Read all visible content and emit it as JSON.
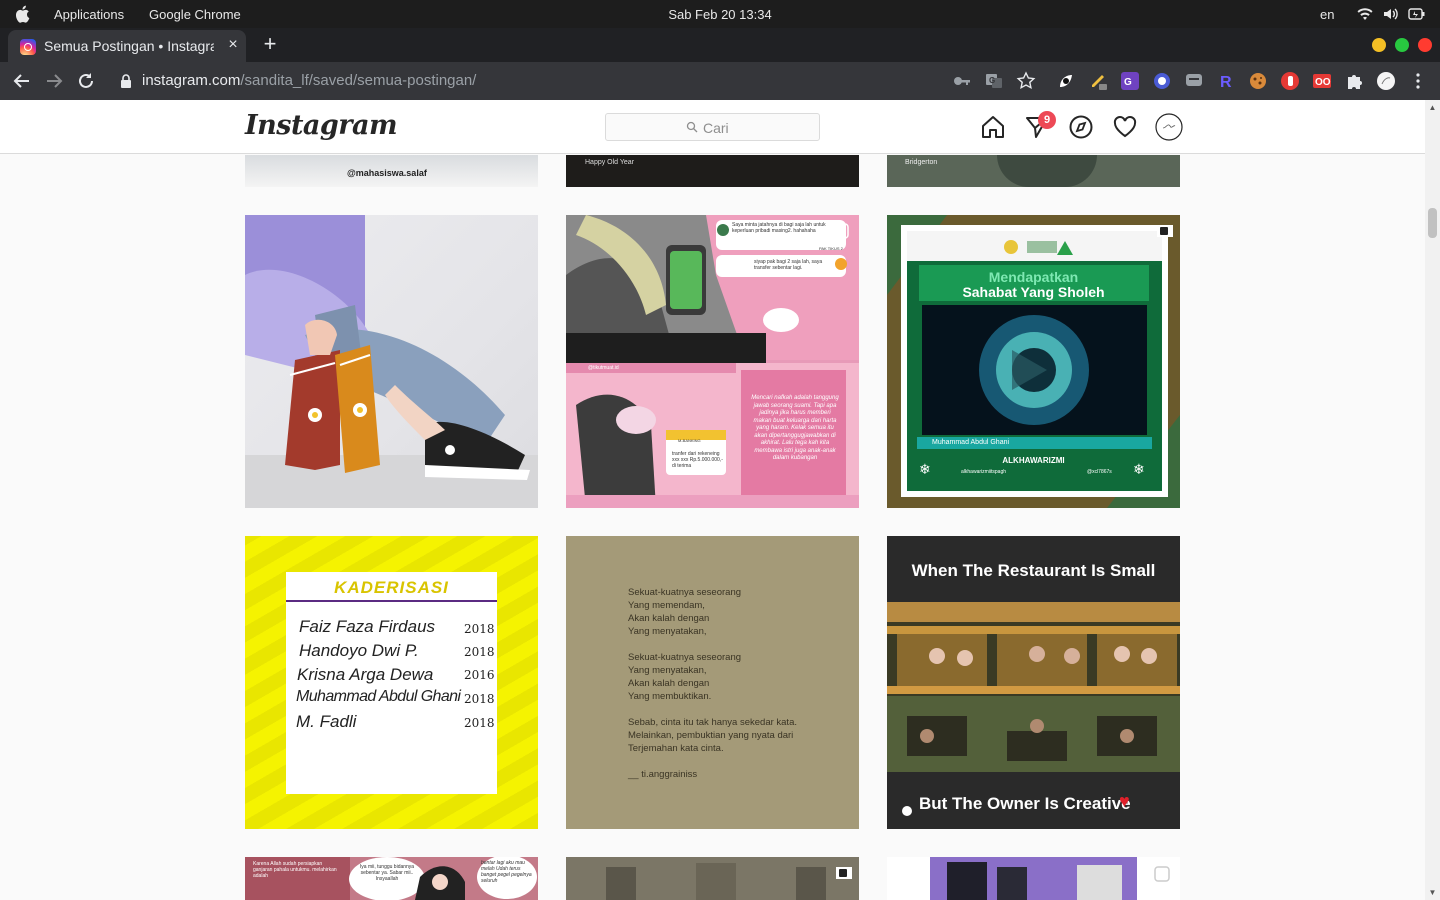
{
  "os": {
    "menu": [
      "Applications",
      "Google Chrome"
    ],
    "clock": "Sab Feb 20  13:34",
    "lang": "en"
  },
  "browser": {
    "tab_title": "Semua Postingan • Instagram",
    "tab_close": "×",
    "new_tab": "+",
    "url_host": "instagram.com",
    "url_path": "/sandita_lf/saved/semua-postingan/",
    "extensions": [
      "key-icon",
      "translate-icon",
      "star-icon",
      "ext-leaf-icon",
      "ext-pen-icon",
      "ext-translate-icon",
      "ext-circle-icon",
      "ext-chat-icon",
      "ext-r-icon",
      "ext-cookie-icon",
      "ext-hand-icon",
      "ext-oo-icon",
      "puzzle-icon",
      "profile-icon",
      "more-icon"
    ]
  },
  "instagram": {
    "logo": "Instagram",
    "search_placeholder": "Cari",
    "notification_count": "9",
    "colors": {
      "badge": "#ed4956",
      "border": "#dbdbdb"
    }
  },
  "posts": {
    "row0": [
      "@mahasiswa.salaf",
      "Happy Old Year",
      "Bridgerton"
    ],
    "pink_chat": {
      "bubble1": "Saya minta jatahnya di bagi saja lah untuk keperluan pribadi masing2. hahahaha",
      "pak": "PAK TIKUS 2",
      "bubble2": "siyap pak bagi 2 saja lah, saya transfer sebentar lagi.",
      "watermark": "@tikutmuat.id",
      "bank": "M-BANKING",
      "transfer": "tranfer dari rekeneing xxx xxx Rp.5.000.000,- di terima",
      "paragraph": "Mencari nafkah adalah tanggung jawab seorang suami. Tapi apa jadinya jika harus memberi makan buat keluarga dari harta yang haram. Kelak semua itu akan dipertanggugjawabkan di akhirat. Lalu tega kah kita membawa istri juga anak-anak dalam kubangan"
    },
    "green_video": {
      "title1": "Mendapatkan",
      "title2": "Sahabat Yang Sholeh",
      "name": "Muhammad Abdul Ghani",
      "brand": "ALKHAWARIZMI",
      "ig": "alkhawarizmiitspagh",
      "line": "@xcl7867s"
    },
    "kaderisasi": {
      "title": "KADERISASI",
      "rows": [
        {
          "name": "Faiz Faza Firdaus",
          "year": "2018"
        },
        {
          "name": "Handoyo Dwi P.",
          "year": "2018"
        },
        {
          "name": "Krisna Arga Dewa",
          "year": "2016"
        },
        {
          "name": "Muhammad Abdul Ghani",
          "year": "2018"
        },
        {
          "name": "M. Fadli",
          "year": "2018"
        }
      ]
    },
    "poem": {
      "lines": [
        "Sekuat-kuatnya seseorang",
        "Yang memendam,",
        "Akan kalah dengan",
        "Yang menyatakan,",
        "",
        "Sekuat-kuatnya seseorang",
        "Yang menyatakan,",
        "Akan kalah dengan",
        "Yang membuktikan.",
        "",
        "Sebab, cinta itu tak hanya sekedar kata.",
        "Melainkan, pembuktian yang nyata dari",
        "Terjemahan kata cinta.",
        "",
        "__ ti.anggrainiss"
      ]
    },
    "restaurant": {
      "top": "When The Restaurant Is Small",
      "bottom": "But The Owner Is Creative"
    },
    "bottom_row": {
      "bubble1": "Iya mii, tunggu bidannya sebentar ya. Sabar mii.. Insyaallah",
      "bubble2": "bentar lagi aku mau melah Udah terus banget pegel pegelnya seluruh",
      "left": "Karena Allah sudah persiapkan ganjaran pahala untukmu. melahirkan adalah"
    }
  }
}
